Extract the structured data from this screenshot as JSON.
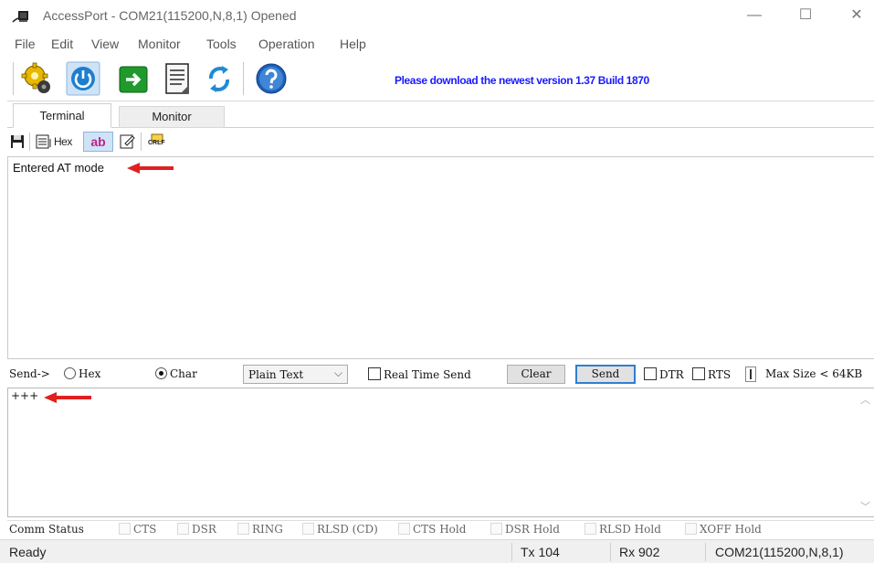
{
  "window": {
    "title": "AccessPort - COM21(115200,N,8,1) Opened",
    "minimize_glyph": "—",
    "maximize_glyph": "☐",
    "close_glyph": "✕"
  },
  "menu": [
    "File",
    "Edit",
    "View",
    "Monitor",
    "Tools",
    "Operation",
    "Help"
  ],
  "toolbar": {
    "buttons": [
      "settings-gear-icon",
      "power-open-icon",
      "go-arrow-icon",
      "notepad-icon",
      "refresh-icon",
      "help-icon"
    ],
    "notice": "Please download the newest version 1.37 Build 1870"
  },
  "tabs": {
    "terminal": "Terminal",
    "monitor": "Monitor"
  },
  "term_toolbar": {
    "hex": "Hex",
    "ab": "ab",
    "crlf": "CRLF"
  },
  "receive": {
    "text": "Entered AT mode"
  },
  "send_controls": {
    "send_label": "Send->",
    "hex_label": "Hex",
    "char_label": "Char",
    "selected_mode": "Char",
    "format_value": "Plain Text",
    "realtime_label": "Real Time Send",
    "clear_label": "Clear",
    "send_button": "Send",
    "dtr_label": "DTR",
    "rts_label": "RTS",
    "max_size": "Max Size < 64KB"
  },
  "send_input": {
    "value": "+++"
  },
  "comm_status": {
    "label": "Comm Status",
    "items": [
      "CTS",
      "DSR",
      "RING",
      "RLSD (CD)",
      "CTS Hold",
      "DSR Hold",
      "RLSD Hold",
      "XOFF Hold"
    ]
  },
  "statusbar": {
    "state": "Ready",
    "tx": "Tx 104",
    "rx": "Rx 902",
    "port": "COM21(115200,N,8,1)"
  },
  "colors": {
    "notice": "#1a1aff",
    "arrow": "#e02020",
    "send_focus": "#2f7fd0"
  }
}
